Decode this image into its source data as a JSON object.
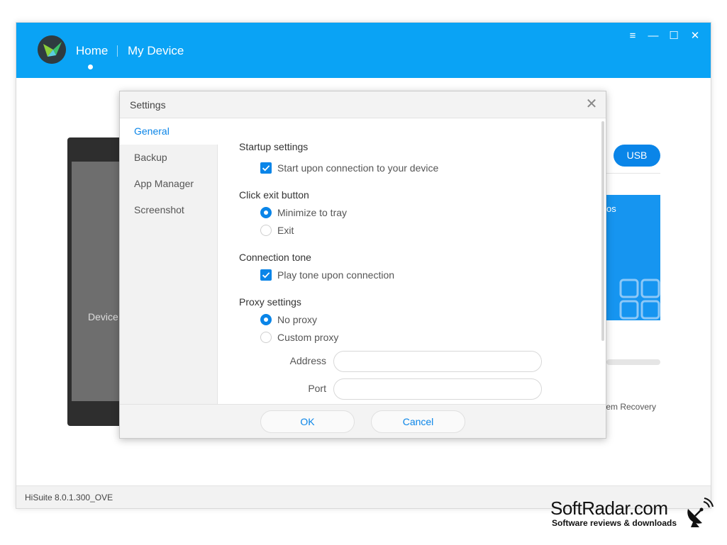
{
  "app": {
    "nav": {
      "home": "Home",
      "my_device": "My Device"
    },
    "window_controls": {
      "menu": "≡",
      "minimize": "—",
      "maximize": "☐",
      "close": "✕"
    },
    "background": {
      "device_label": "Device",
      "usb_label": "USB",
      "tile_text": "os",
      "recovery_text": "tem Recovery"
    },
    "footer_version": "HiSuite 8.0.1.300_OVE",
    "colors": {
      "header": "#0aa3f5",
      "accent": "#0a85e8"
    }
  },
  "dialog": {
    "title": "Settings",
    "close_icon": "✕",
    "sidebar": [
      {
        "label": "General",
        "active": true
      },
      {
        "label": "Backup",
        "active": false
      },
      {
        "label": "App Manager",
        "active": false
      },
      {
        "label": "Screenshot",
        "active": false
      }
    ],
    "sections": {
      "startup": {
        "title": "Startup settings",
        "option": "Start upon connection to your device",
        "checked": true
      },
      "exit": {
        "title": "Click exit button",
        "options": [
          "Minimize to tray",
          "Exit"
        ],
        "selected": "Minimize to tray"
      },
      "tone": {
        "title": "Connection tone",
        "option": "Play tone upon connection",
        "checked": true
      },
      "proxy": {
        "title": "Proxy settings",
        "options": [
          "No proxy",
          "Custom proxy"
        ],
        "selected": "No proxy",
        "address_label": "Address",
        "port_label": "Port",
        "address_value": "",
        "port_value": ""
      }
    },
    "buttons": {
      "ok": "OK",
      "cancel": "Cancel"
    }
  },
  "watermark": {
    "title": "SoftRadar.com",
    "subtitle": "Software reviews & downloads"
  }
}
